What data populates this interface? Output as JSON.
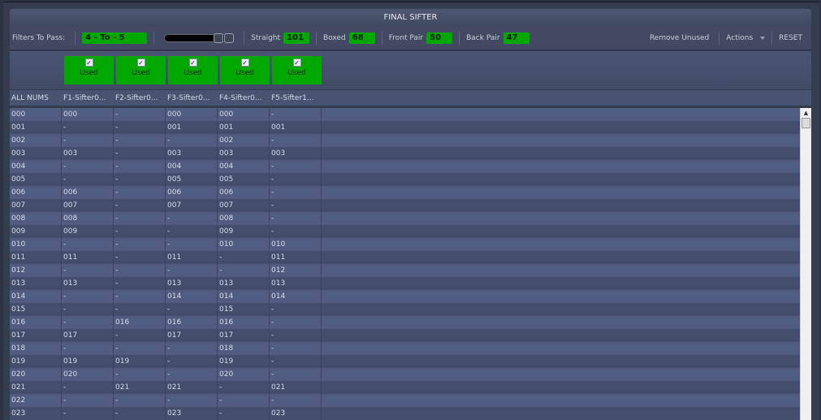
{
  "title": "FINAL SIFTER",
  "toolbar": {
    "filters_label": "Filters To Pass:",
    "filters_value": "4 - To - 5",
    "slider_range": [
      4,
      5
    ],
    "straight_label": "Straight",
    "straight_value": "101",
    "boxed_label": "Boxed",
    "boxed_value": "68",
    "front_pair_label": "Front Pair",
    "front_pair_value": "50",
    "back_pair_label": "Back Pair",
    "back_pair_value": "47",
    "remove_unused": "Remove Unused",
    "actions": "Actions",
    "reset": "RESET"
  },
  "filters": [
    {
      "label": "Used",
      "checked": true
    },
    {
      "label": "Used",
      "checked": true
    },
    {
      "label": "Used",
      "checked": true
    },
    {
      "label": "Used",
      "checked": true
    },
    {
      "label": "Used",
      "checked": true
    }
  ],
  "columns": [
    "ALL NUMS",
    "F1-Sifter0...",
    "F2-Sifter0...",
    "F3-Sifter0...",
    "F4-Sifter0...",
    "F5-Sifter1..."
  ],
  "rows": [
    [
      "000",
      "000",
      "-",
      "000",
      "000",
      "-"
    ],
    [
      "001",
      "-",
      "-",
      "001",
      "001",
      "001"
    ],
    [
      "002",
      "-",
      "-",
      "-",
      "002",
      "-"
    ],
    [
      "003",
      "003",
      "-",
      "003",
      "003",
      "003"
    ],
    [
      "004",
      "-",
      "-",
      "004",
      "004",
      "-"
    ],
    [
      "005",
      "-",
      "-",
      "005",
      "005",
      "-"
    ],
    [
      "006",
      "006",
      "-",
      "006",
      "006",
      "-"
    ],
    [
      "007",
      "007",
      "-",
      "007",
      "007",
      "-"
    ],
    [
      "008",
      "008",
      "-",
      "-",
      "008",
      "-"
    ],
    [
      "009",
      "009",
      "-",
      "-",
      "009",
      "-"
    ],
    [
      "010",
      "-",
      "-",
      "-",
      "010",
      "010"
    ],
    [
      "011",
      "011",
      "-",
      "011",
      "-",
      "011"
    ],
    [
      "012",
      "-",
      "-",
      "-",
      "-",
      "012"
    ],
    [
      "013",
      "013",
      "-",
      "013",
      "013",
      "013"
    ],
    [
      "014",
      "-",
      "-",
      "014",
      "014",
      "014"
    ],
    [
      "015",
      "-",
      "-",
      "-",
      "015",
      "-"
    ],
    [
      "016",
      "-",
      "016",
      "016",
      "016",
      "-"
    ],
    [
      "017",
      "017",
      "-",
      "017",
      "017",
      "-"
    ],
    [
      "018",
      "-",
      "-",
      "-",
      "018",
      "-"
    ],
    [
      "019",
      "019",
      "019",
      "-",
      "019",
      "-"
    ],
    [
      "020",
      "020",
      "-",
      "-",
      "020",
      "-"
    ],
    [
      "021",
      "-",
      "021",
      "021",
      "-",
      "021"
    ],
    [
      "022",
      "-",
      "-",
      "-",
      "-",
      "-"
    ],
    [
      "023",
      "-",
      "-",
      "023",
      "-",
      "023"
    ]
  ],
  "colors": {
    "accent_green": "#00a800",
    "row_light": "#505d80",
    "row_dark": "#434e6d"
  }
}
